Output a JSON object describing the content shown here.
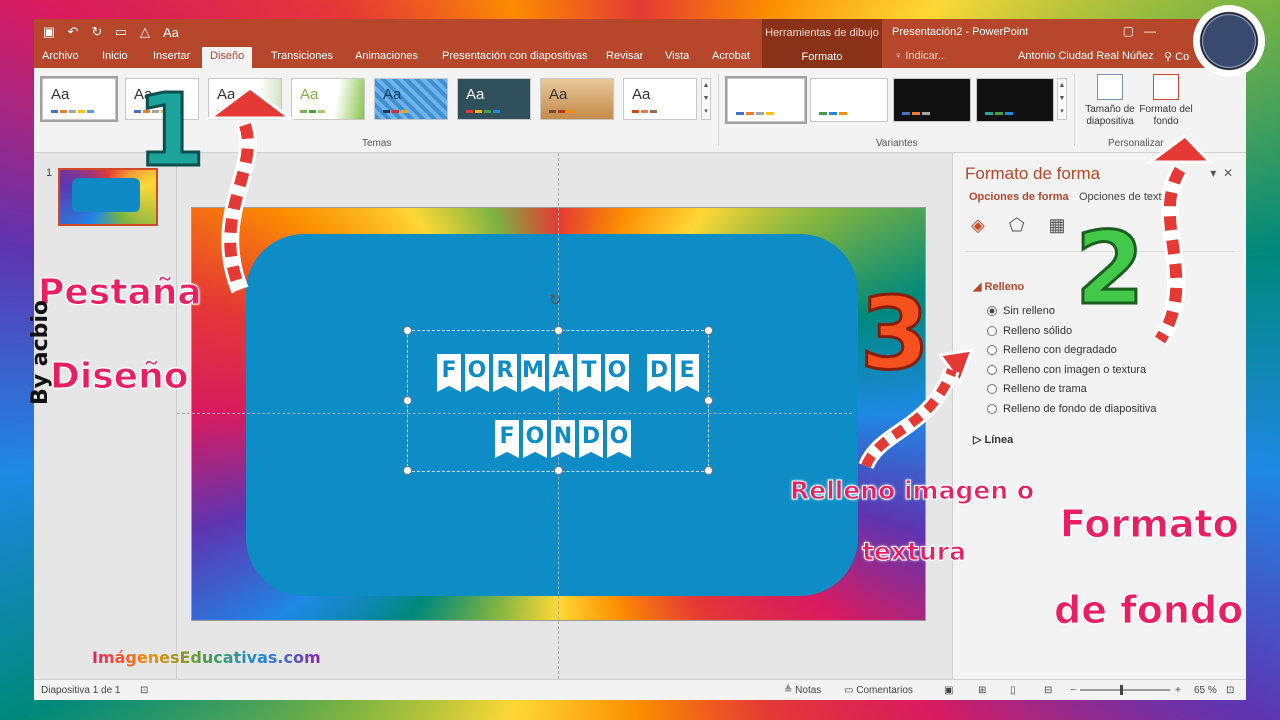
{
  "titlebar": {
    "document_title": "Presentación2 - PowerPoint",
    "context_tab_group": "Herramientas de dibujo",
    "context_tab": "Formato",
    "user": "Antonio Ciudad Real Núñez",
    "share_label": "Co"
  },
  "qat": {
    "icons": [
      "save-icon",
      "undo-icon",
      "redo-icon",
      "start-slideshow-icon",
      "draw-shape-icon",
      "font-size-icon"
    ],
    "font_size_label": "Aa"
  },
  "tabs": [
    {
      "label": "Archivo"
    },
    {
      "label": "Inicio"
    },
    {
      "label": "Insertar"
    },
    {
      "label": "Diseño",
      "active": true
    },
    {
      "label": "Transiciones"
    },
    {
      "label": "Animaciones"
    },
    {
      "label": "Presentación con diapositivas"
    },
    {
      "label": "Revisar"
    },
    {
      "label": "Vista"
    },
    {
      "label": "Acrobat"
    }
  ],
  "tell_me": "Indicar...",
  "ribbon": {
    "theme_label": "Aa",
    "themes_group": "Temas",
    "variants_group": "Variantes",
    "customize_group": "Personalizar",
    "slide_size": "Tamaño de diapositiva",
    "format_background": "Formato del fondo"
  },
  "thumbnails": {
    "number": "1"
  },
  "slide": {
    "title_line1": "FORMATO DE",
    "title_line2": "FONDO"
  },
  "format_pane": {
    "title": "Formato de forma",
    "tab_shape": "Opciones de forma",
    "tab_text": "Opciones de texto",
    "section_fill": "Relleno",
    "fill_options": [
      {
        "label": "Sin relleno",
        "selected": true
      },
      {
        "label": "Relleno sólido",
        "selected": false
      },
      {
        "label": "Relleno con degradado",
        "selected": false
      },
      {
        "label": "Relleno con imagen o textura",
        "selected": false
      },
      {
        "label": "Relleno de trama",
        "selected": false
      },
      {
        "label": "Relleno de fondo de diapositiva",
        "selected": false
      }
    ],
    "section_line": "Línea"
  },
  "statusbar": {
    "slide_counter": "Diapositiva 1 de 1",
    "notes": "Notas",
    "comments": "Comentarios",
    "zoom": "65 %"
  },
  "annotations": {
    "num1": "1",
    "num2": "2",
    "num3": "3",
    "tab_line1": "Pestaña",
    "tab_line2": "Diseño",
    "fill_line1": "Relleno imagen o",
    "fill_line2": "textura",
    "bg_line1": "Formato",
    "bg_line2": "de fondo",
    "credit": "By acbio",
    "site": "ImágenesEducativas.com"
  },
  "colors": {
    "accent": "#b7472a",
    "slide_card": "#0e8cc6",
    "annotation_pink": "#e91e63",
    "num1": "#1ba39c",
    "num2": "#43c94a",
    "num3": "#f4511e"
  }
}
